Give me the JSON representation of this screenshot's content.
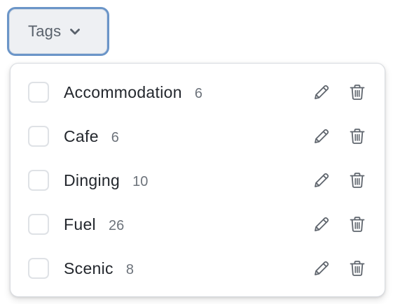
{
  "tags_button": {
    "label": "Tags",
    "icon": "chevron-down-icon"
  },
  "tags": [
    {
      "name": "Accommodation",
      "count": "6"
    },
    {
      "name": "Cafe",
      "count": "6"
    },
    {
      "name": "Dinging",
      "count": "10"
    },
    {
      "name": "Fuel",
      "count": "26"
    },
    {
      "name": "Scenic",
      "count": "8"
    }
  ],
  "icons": {
    "edit": "pencil-icon",
    "delete": "trash-icon"
  },
  "colors": {
    "button_border": "#6b95c8",
    "button_bg": "#eef0f3",
    "text": "#23272d",
    "count": "#6d737b",
    "icon": "#5f656d"
  }
}
